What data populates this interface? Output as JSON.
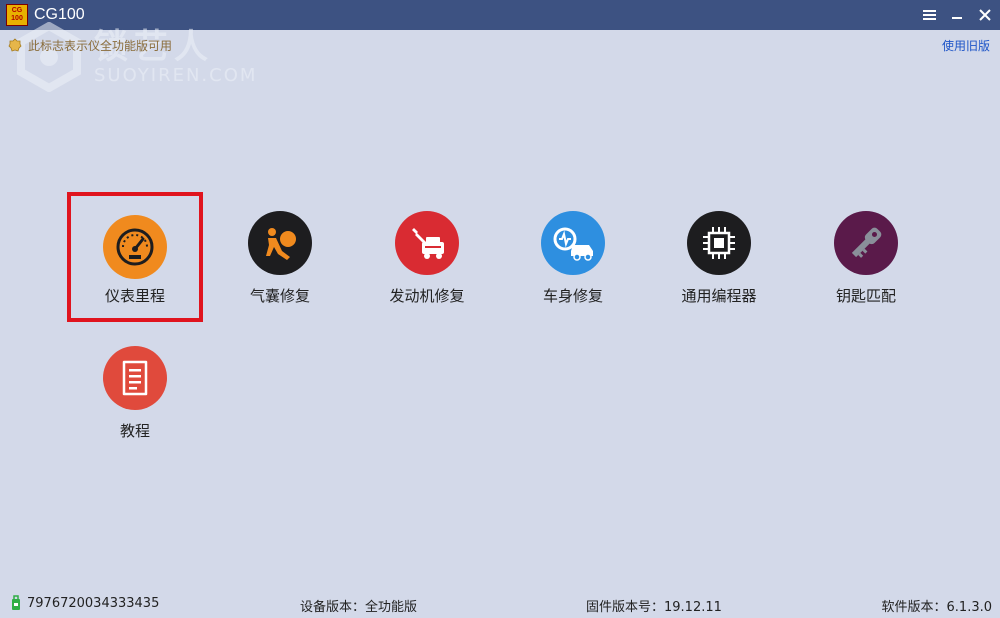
{
  "window": {
    "title": "CG100",
    "logo_top": "CG",
    "logo_bottom": "100"
  },
  "notice": {
    "text": "此标志表示仪全功能版可用"
  },
  "old_version_link": "使用旧版",
  "watermark": {
    "cn": "锁艺人",
    "en": "SUOYIREN.COM"
  },
  "tiles": [
    {
      "label": "仪表里程",
      "icon": "speedometer-icon",
      "color": "#f08a1e",
      "selected": true
    },
    {
      "label": "气囊修复",
      "icon": "airbag-icon",
      "color": "#1d1d1f"
    },
    {
      "label": "发动机修复",
      "icon": "engine-repair-icon",
      "color": "#d92b32"
    },
    {
      "label": "车身修复",
      "icon": "car-body-icon",
      "color": "#2e8fe0"
    },
    {
      "label": "通用编程器",
      "icon": "chip-icon",
      "color": "#1d1d1f"
    },
    {
      "label": "钥匙匹配",
      "icon": "key-icon",
      "color": "#5a1a4a"
    },
    {
      "label": "教程",
      "icon": "document-icon",
      "color": "#e04a3c"
    }
  ],
  "status": {
    "serial": "7976720034333435",
    "device_version": "设备版本：全功能版",
    "firmware_version": "固件版本号：19.12.11",
    "software_version": "软件版本：6.1.3.0"
  },
  "colors": {
    "titlebar": "#3d5282",
    "background": "#d3d9e9",
    "highlight": "#e0141e",
    "link": "#1e55c8"
  }
}
